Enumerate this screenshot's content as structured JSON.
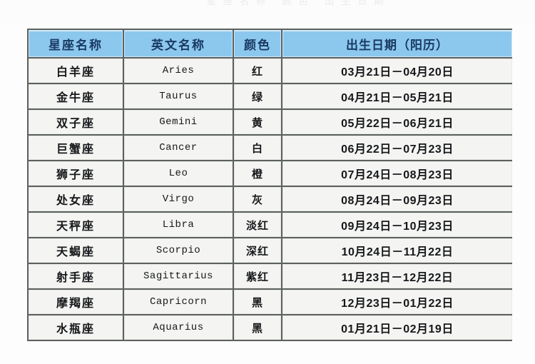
{
  "page": {
    "ghost_row_text": "星座名称  颜色  出生日期"
  },
  "table": {
    "columns": [
      {
        "key": "name",
        "label": "星座名称"
      },
      {
        "key": "eng",
        "label": "英文名称"
      },
      {
        "key": "color",
        "label": "颜色"
      },
      {
        "key": "date",
        "label": "出生日期（阳历）"
      }
    ],
    "rows": [
      {
        "name": "白羊座",
        "eng": "Aries",
        "color": "红",
        "date": "03月21日－04月20日"
      },
      {
        "name": "金牛座",
        "eng": "Taurus",
        "color": "绿",
        "date": "04月21日－05月21日"
      },
      {
        "name": "双子座",
        "eng": "Gemini",
        "color": "黄",
        "date": "05月22日－06月21日"
      },
      {
        "name": "巨蟹座",
        "eng": "Cancer",
        "color": "白",
        "date": "06月22日－07月23日"
      },
      {
        "name": "狮子座",
        "eng": "Leo",
        "color": "橙",
        "date": "07月24日－08月23日"
      },
      {
        "name": "处女座",
        "eng": "Virgo",
        "color": "灰",
        "date": "08月24日－09月23日"
      },
      {
        "name": "天秤座",
        "eng": "Libra",
        "color": "淡红",
        "date": "09月24日－10月23日"
      },
      {
        "name": "天蝎座",
        "eng": "Scorpio",
        "color": "深红",
        "date": "10月24日－11月22日"
      },
      {
        "name": "射手座",
        "eng": "Sagittarius",
        "color": "紫红",
        "date": "11月23日－12月22日"
      },
      {
        "name": "摩羯座",
        "eng": "Capricorn",
        "color": "黑",
        "date": "12月23日－01月22日"
      },
      {
        "name": "水瓶座",
        "eng": "Aquarius",
        "color": "黑",
        "date": "01月21日－02月19日"
      }
    ]
  },
  "colors": {
    "header_blue": "#8cc8ee",
    "header_text": "#1a3a63",
    "cell_bg": "#f4f5f2",
    "grid_line": "#5d615e",
    "page_bg": "#fdfdfd"
  }
}
